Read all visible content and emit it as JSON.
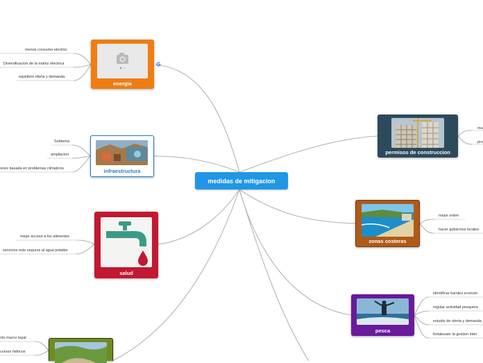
{
  "root": {
    "label": "medidas de mitigacion"
  },
  "colors": {
    "root": "#2196e6",
    "energia": "#ef7d12",
    "infraestructura": "#1e7ec9",
    "salud": "#c21832",
    "permisos": "#2d4a5d",
    "costeras": "#b05a18",
    "pesca": "#6a1a9a",
    "recursos": "#6f8d1e"
  },
  "energia": {
    "label": "energia",
    "icon": "camera-icon",
    "leaves": [
      "menos consumo electrici",
      "Diversificacion de la matriz electrica",
      "equilibrio oferta y demanda"
    ]
  },
  "infraestructura": {
    "label": "infraestructura",
    "leaves": [
      "Subtema",
      "ampliacion",
      "ones basada en problemas climaticos"
    ]
  },
  "salud": {
    "label": "salud",
    "icon": "faucet-icon",
    "leaves": [
      "mejor acceso a los alimentos",
      "servicios más seguros al agua potable"
    ]
  },
  "permisos": {
    "label": "permisos de construccion",
    "leaves": [
      "ma",
      "pro"
    ]
  },
  "costeras": {
    "label": "zonas costeras",
    "leaves": [
      "mejor orden",
      "hacer gobiernos locales"
    ]
  },
  "pesca": {
    "label": "pesca",
    "leaves": [
      "identificar fuentes econom",
      "regular actividad pesquera",
      "estudio de oferta y demanda",
      "fortalezaer la gestion inter"
    ]
  },
  "recursos": {
    "leaves": [
      "nto marco legal",
      "cursos hidricos"
    ]
  }
}
